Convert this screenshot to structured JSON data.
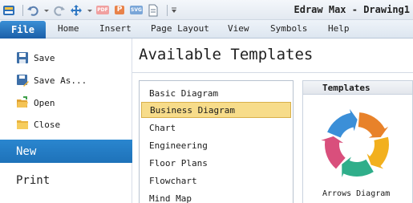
{
  "window": {
    "title": "Edraw Max - Drawing1"
  },
  "quick_access": [
    {
      "name": "app-menu-icon"
    },
    {
      "name": "undo-icon"
    },
    {
      "name": "redo-icon"
    },
    {
      "name": "move-icon"
    },
    {
      "name": "pdf-export-icon",
      "label": "PDF"
    },
    {
      "name": "ppt-export-icon",
      "label": "P"
    },
    {
      "name": "svg-export-icon",
      "label": "SVG"
    },
    {
      "name": "document-icon"
    },
    {
      "name": "customize-dropdown-icon"
    }
  ],
  "tabs": {
    "file": "File",
    "home": "Home",
    "insert": "Insert",
    "page_layout": "Page Layout",
    "view": "View",
    "symbols": "Symbols",
    "help": "Help"
  },
  "backstage": {
    "save": "Save",
    "save_as": "Save As...",
    "open": "Open",
    "close": "Close",
    "new": "New",
    "print": "Print"
  },
  "main": {
    "title": "Available Templates",
    "categories": [
      "Basic Diagram",
      "Business Diagram",
      "Chart",
      "Engineering",
      "Floor Plans",
      "Flowchart",
      "Mind Map"
    ],
    "selected_category": "Business Diagram",
    "preview": {
      "header": "Templates",
      "item_label": "Arrows Diagram",
      "colors": [
        "#e8822a",
        "#f2b01e",
        "#2fae8a",
        "#d94f7c",
        "#3b8fd8"
      ]
    }
  }
}
